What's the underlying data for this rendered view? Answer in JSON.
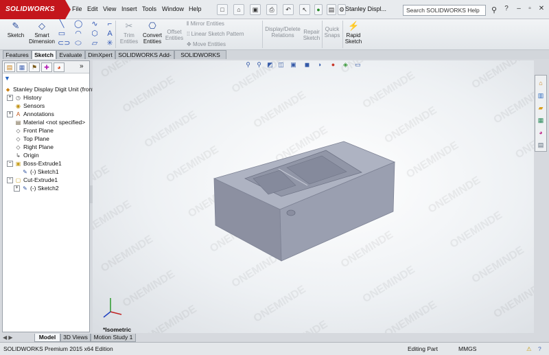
{
  "app": {
    "brand": "SOLIDWORKS",
    "document_title": "Stanley Displ...",
    "brand_color": "#c4161c"
  },
  "menu": [
    "File",
    "Edit",
    "View",
    "Insert",
    "Tools",
    "Window",
    "Help"
  ],
  "search": {
    "placeholder": "Search SOLIDWORKS Help"
  },
  "commands": {
    "sketch": "Sketch",
    "smart_dimension": [
      "Smart",
      "Dimension"
    ],
    "trim": [
      "Trim",
      "Entities"
    ],
    "convert": [
      "Convert",
      "Entities"
    ],
    "offset": [
      "Offset",
      "Entities"
    ],
    "mirror": "Mirror Entities",
    "linear_pattern": "Linear Sketch Pattern",
    "move": "Move Entities",
    "display_delete": [
      "Display/Delete",
      "Relations"
    ],
    "repair": [
      "Repair",
      "Sketch"
    ],
    "quick_snaps": [
      "Quick",
      "Snaps"
    ],
    "rapid_sketch": [
      "Rapid",
      "Sketch"
    ]
  },
  "tabs": [
    "Features",
    "Sketch",
    "Evaluate",
    "DimXpert",
    "SOLIDWORKS Add-Ins",
    "SOLIDWORKS MBD"
  ],
  "active_tab": "Sketch",
  "tree": {
    "root": "Stanley Display Digit Unit (front",
    "items": [
      {
        "label": "History",
        "indent": 1,
        "expand": "+",
        "icon": "history-icon"
      },
      {
        "label": "Sensors",
        "indent": 1,
        "expand": "",
        "icon": "sensor-icon"
      },
      {
        "label": "Annotations",
        "indent": 1,
        "expand": "+",
        "icon": "annotation-icon"
      },
      {
        "label": "Material <not specified>",
        "indent": 1,
        "expand": "",
        "icon": "material-icon"
      },
      {
        "label": "Front Plane",
        "indent": 1,
        "expand": "",
        "icon": "plane-icon"
      },
      {
        "label": "Top Plane",
        "indent": 1,
        "expand": "",
        "icon": "plane-icon"
      },
      {
        "label": "Right Plane",
        "indent": 1,
        "expand": "",
        "icon": "plane-icon"
      },
      {
        "label": "Origin",
        "indent": 1,
        "expand": "",
        "icon": "origin-icon"
      },
      {
        "label": "Boss-Extrude1",
        "indent": 1,
        "expand": "−",
        "icon": "extrude-icon"
      },
      {
        "label": "(-) Sketch1",
        "indent": 2,
        "expand": "",
        "icon": "sketch-icon"
      },
      {
        "label": "Cut-Extrude1",
        "indent": 1,
        "expand": "−",
        "icon": "cut-extrude-icon"
      },
      {
        "label": "(-) Sketch2",
        "indent": 2,
        "expand": "+",
        "icon": "sketch-icon"
      }
    ]
  },
  "viewport": {
    "view_name": "*Isometric",
    "watermark": "ONEMINDE",
    "model_color": "#9ea3b2"
  },
  "bottom_tabs": [
    "Model",
    "3D Views",
    "Motion Study 1"
  ],
  "active_bottom_tab": "Model",
  "status": {
    "edition": "SOLIDWORKS Premium 2015 x64 Edition",
    "mode": "Editing Part",
    "units": "MMGS"
  }
}
